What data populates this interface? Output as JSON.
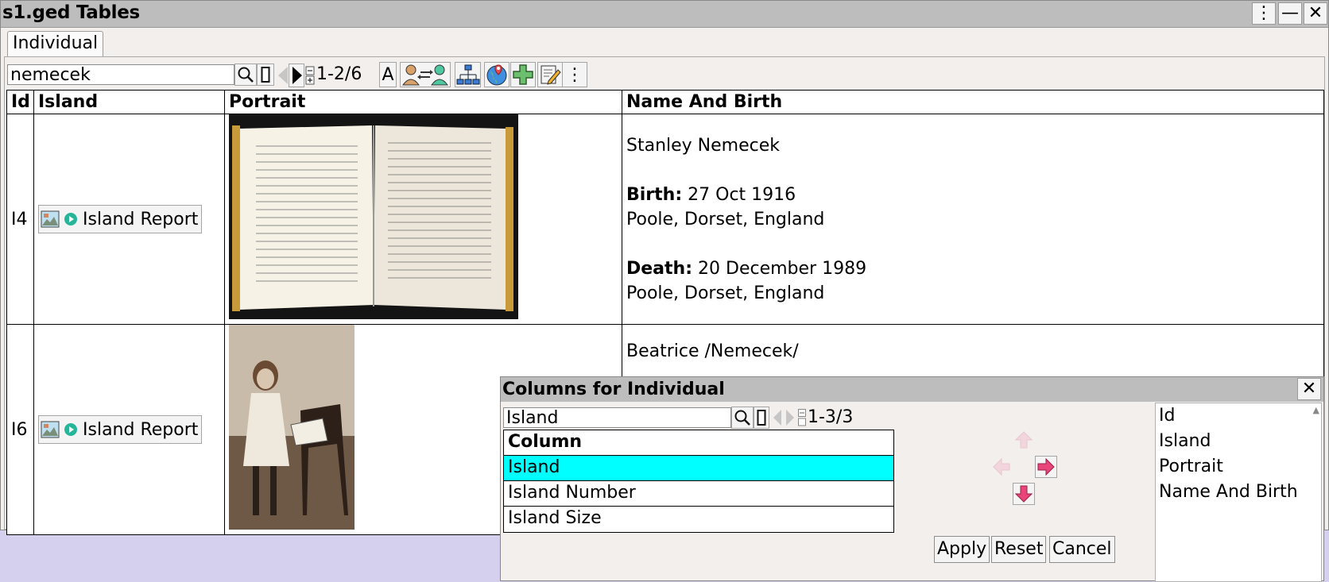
{
  "window": {
    "title": "s1.ged Tables",
    "menu_glyph": "⋮",
    "minimize_glyph": "—",
    "close_glyph": "✕"
  },
  "tab": {
    "label": "Individual"
  },
  "toolbar": {
    "search_value": "nemecek",
    "count": "1-2/6",
    "font_button": "A",
    "more_glyph": "⋮"
  },
  "table": {
    "headers": [
      "Id",
      "Island",
      "Portrait",
      "Name And Birth"
    ],
    "rows": [
      {
        "id": "I4",
        "report": "Island Report",
        "name": "Stanley Nemecek",
        "birth_label": "Birth:",
        "birth_date": "27 Oct 1916",
        "birth_place": "Poole, Dorset, England",
        "death_label": "Death:",
        "death_date": "20 December 1989",
        "death_place": "Poole, Dorset, England"
      },
      {
        "id": "I6",
        "report": "Island Report",
        "name": "Beatrice /Nemecek/"
      }
    ]
  },
  "dialog": {
    "title": "Columns for Individual",
    "close_glyph": "✕",
    "search_value": "Island",
    "count": "1-3/3",
    "column_header": "Column",
    "available": [
      "Island",
      "Island Number",
      "Island Size"
    ],
    "selected_index": 0,
    "selected_columns": [
      "Id",
      "Island",
      "Portrait",
      "Name And Birth"
    ],
    "buttons": {
      "apply": "Apply",
      "reset": "Reset",
      "cancel": "Cancel"
    }
  },
  "colors": {
    "highlight": "#00ffff",
    "title_bar": "#bdbdbd",
    "arrow_active": "#e8457a",
    "backdrop": "#d4d0ee"
  }
}
